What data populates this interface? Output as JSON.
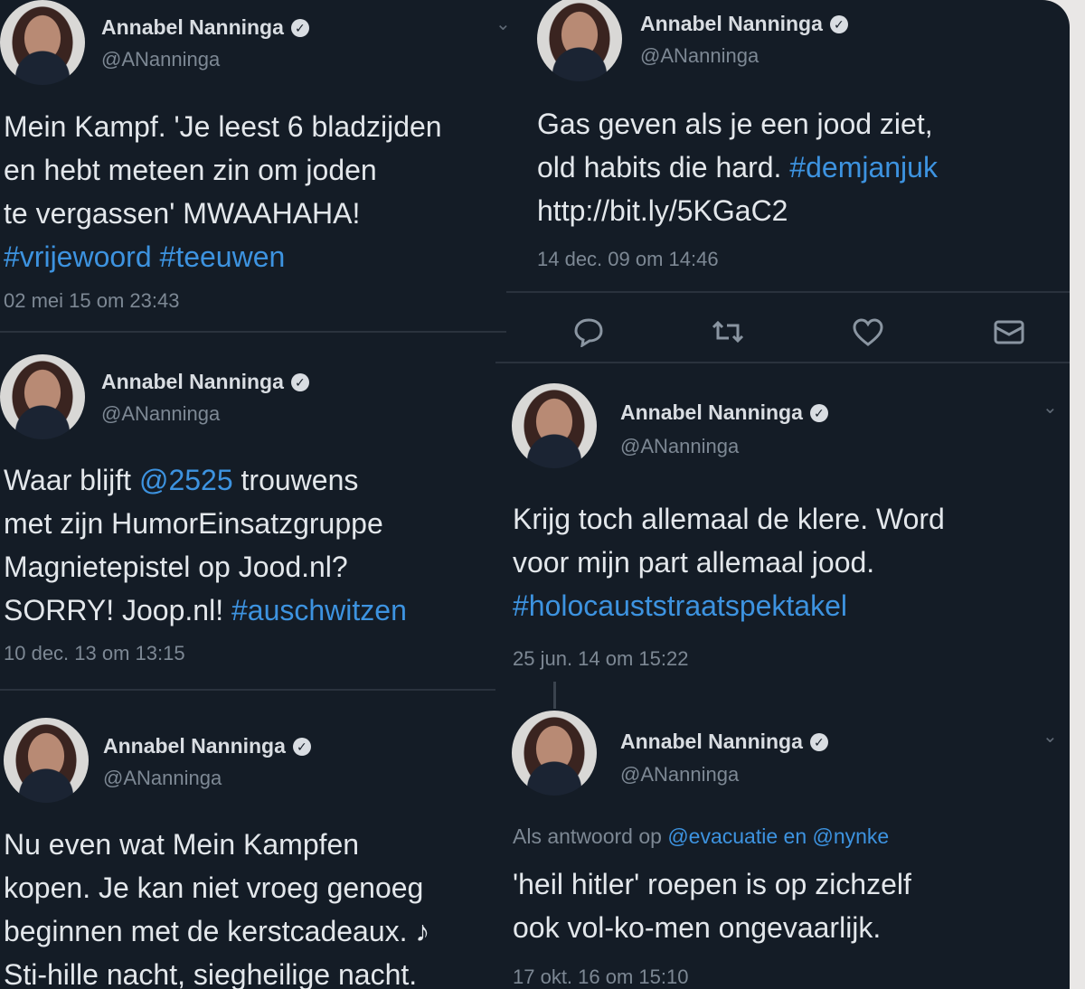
{
  "name": "Annabel Nanninga",
  "handle": "@ANanninga",
  "tweets": [
    {
      "lines": [
        [
          {
            "t": "Mein Kampf. 'Je leest 6 bladzijden"
          }
        ],
        [
          {
            "t": "en hebt meteen zin om joden"
          }
        ],
        [
          {
            "t": "te vergassen' MWAAHAHA!"
          }
        ],
        [
          {
            "t": "#vrijewoord #teeuwen",
            "tag": true
          }
        ]
      ],
      "time": "02 mei 15 om 23:43"
    },
    {
      "lines": [
        [
          {
            "t": "Gas geven als je een jood ziet,"
          }
        ],
        [
          {
            "t": "old habits die hard. "
          },
          {
            "t": "#demjanjuk",
            "tag": true
          }
        ],
        [
          {
            "t": "http://bit.ly/5KGaC2"
          }
        ]
      ],
      "time": "14 dec. 09 om 14:46"
    },
    {
      "lines": [
        [
          {
            "t": "Waar blijft "
          },
          {
            "t": "@2525",
            "tag": true
          },
          {
            "t": " trouwens"
          }
        ],
        [
          {
            "t": "met zijn HumorEinsatzgruppe"
          }
        ],
        [
          {
            "t": "Magnietepistel op Jood.nl?"
          }
        ],
        [
          {
            "t": "SORRY! Joop.nl! "
          },
          {
            "t": "#auschwitzen",
            "tag": true
          }
        ]
      ],
      "time": "10 dec. 13 om 13:15"
    },
    {
      "lines": [
        [
          {
            "t": "Krijg toch allemaal de klere. Word"
          }
        ],
        [
          {
            "t": "voor mijn part allemaal jood."
          }
        ],
        [
          {
            "t": "#holocauststraatspektakel",
            "tag": true
          }
        ]
      ],
      "time": "25 jun. 14 om 15:22"
    },
    {
      "lines": [
        [
          {
            "t": "Nu even wat Mein Kampfen"
          }
        ],
        [
          {
            "t": "kopen. Je kan niet vroeg genoeg"
          }
        ],
        [
          {
            "t": "beginnen met de kerstcadeaux. ♪"
          }
        ],
        [
          {
            "t": "Sti-hille nacht, siegheilige nacht."
          }
        ]
      ],
      "time": ""
    },
    {
      "reply": [
        {
          "t": "Als antwoord op "
        },
        {
          "t": "@evacuatie en @nynke",
          "tag": true
        }
      ],
      "lines": [
        [
          {
            "t": "'heil hitler' roepen is op zichzelf"
          }
        ],
        [
          {
            "t": "ook vol-ko-men ongevaarlijk."
          }
        ]
      ],
      "time": "17 okt. 16 om 15:10"
    }
  ],
  "actions": [
    "reply-icon",
    "retweet-icon",
    "like-icon",
    "message-icon"
  ],
  "colors": {
    "background": "#141c26",
    "link": "#3d93e0",
    "text": "#e3e7eb",
    "muted": "#7d8894"
  }
}
